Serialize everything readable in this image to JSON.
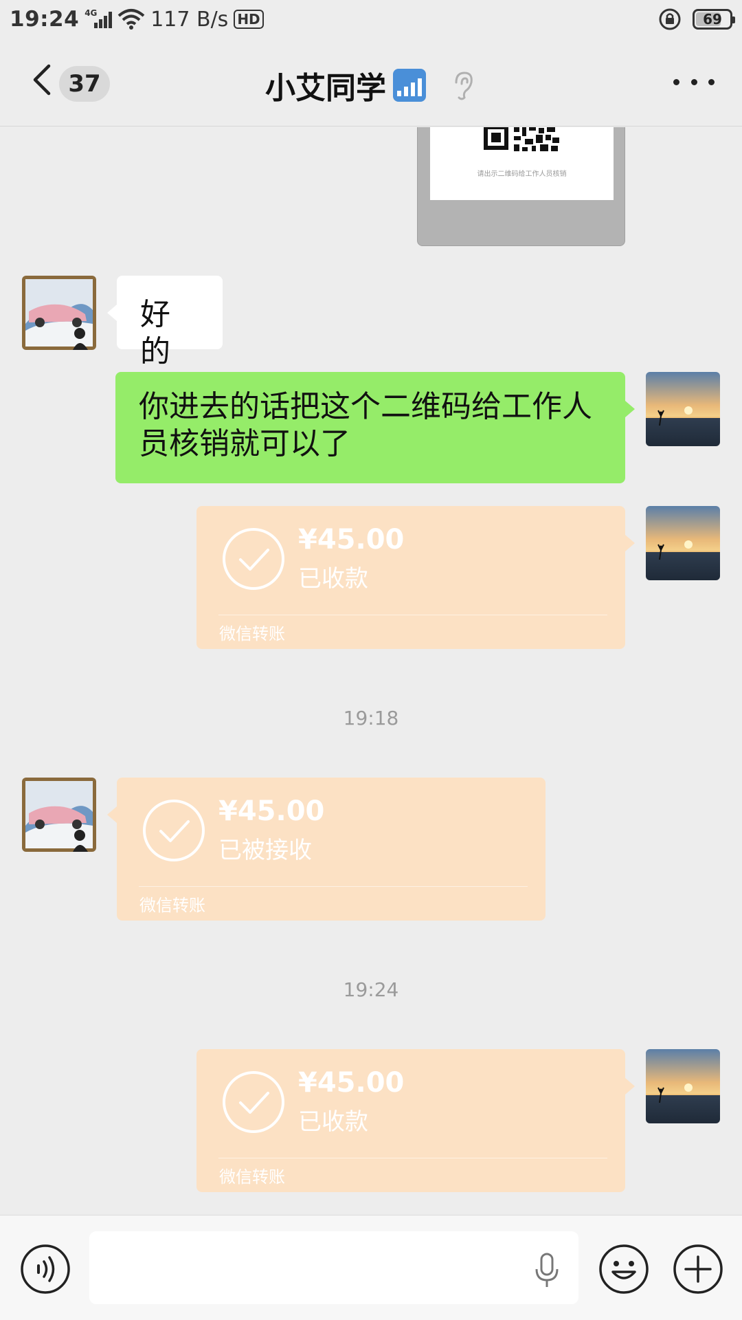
{
  "status_bar": {
    "time": "19:24",
    "network": "4G",
    "speed": "117 B/s",
    "hd": "HD",
    "battery": "69",
    "battery_level_percent": 69
  },
  "header": {
    "unread_count": "37",
    "title": "小艾同学",
    "title_emoji": "signal-bars-icon",
    "icons": [
      "back-arrow-icon",
      "ear-icon",
      "more-dots-icon"
    ]
  },
  "messages": {
    "qr_caption": "请出示二维码给工作人员核销",
    "reply_ok": "好的",
    "instruction": "你进去的话把这个二维码给工作人员核销就可以了",
    "transfer_1": {
      "amount": "¥45.00",
      "state": "已收款",
      "source": "微信转账"
    },
    "time_1": "19:18",
    "transfer_2": {
      "amount": "¥45.00",
      "state": "已被接收",
      "source": "微信转账"
    },
    "time_2": "19:24",
    "transfer_3": {
      "amount": "¥45.00",
      "state": "已收款",
      "source": "微信转账"
    }
  },
  "input_bar": {
    "value": "",
    "icons": [
      "voice-icon",
      "mic-icon",
      "emoji-icon",
      "plus-icon"
    ]
  },
  "colors": {
    "background": "#ededed",
    "green_bubble": "#95ec69",
    "transfer_bubble": "#fce1c4",
    "header_badge": "#d9d9d9"
  }
}
